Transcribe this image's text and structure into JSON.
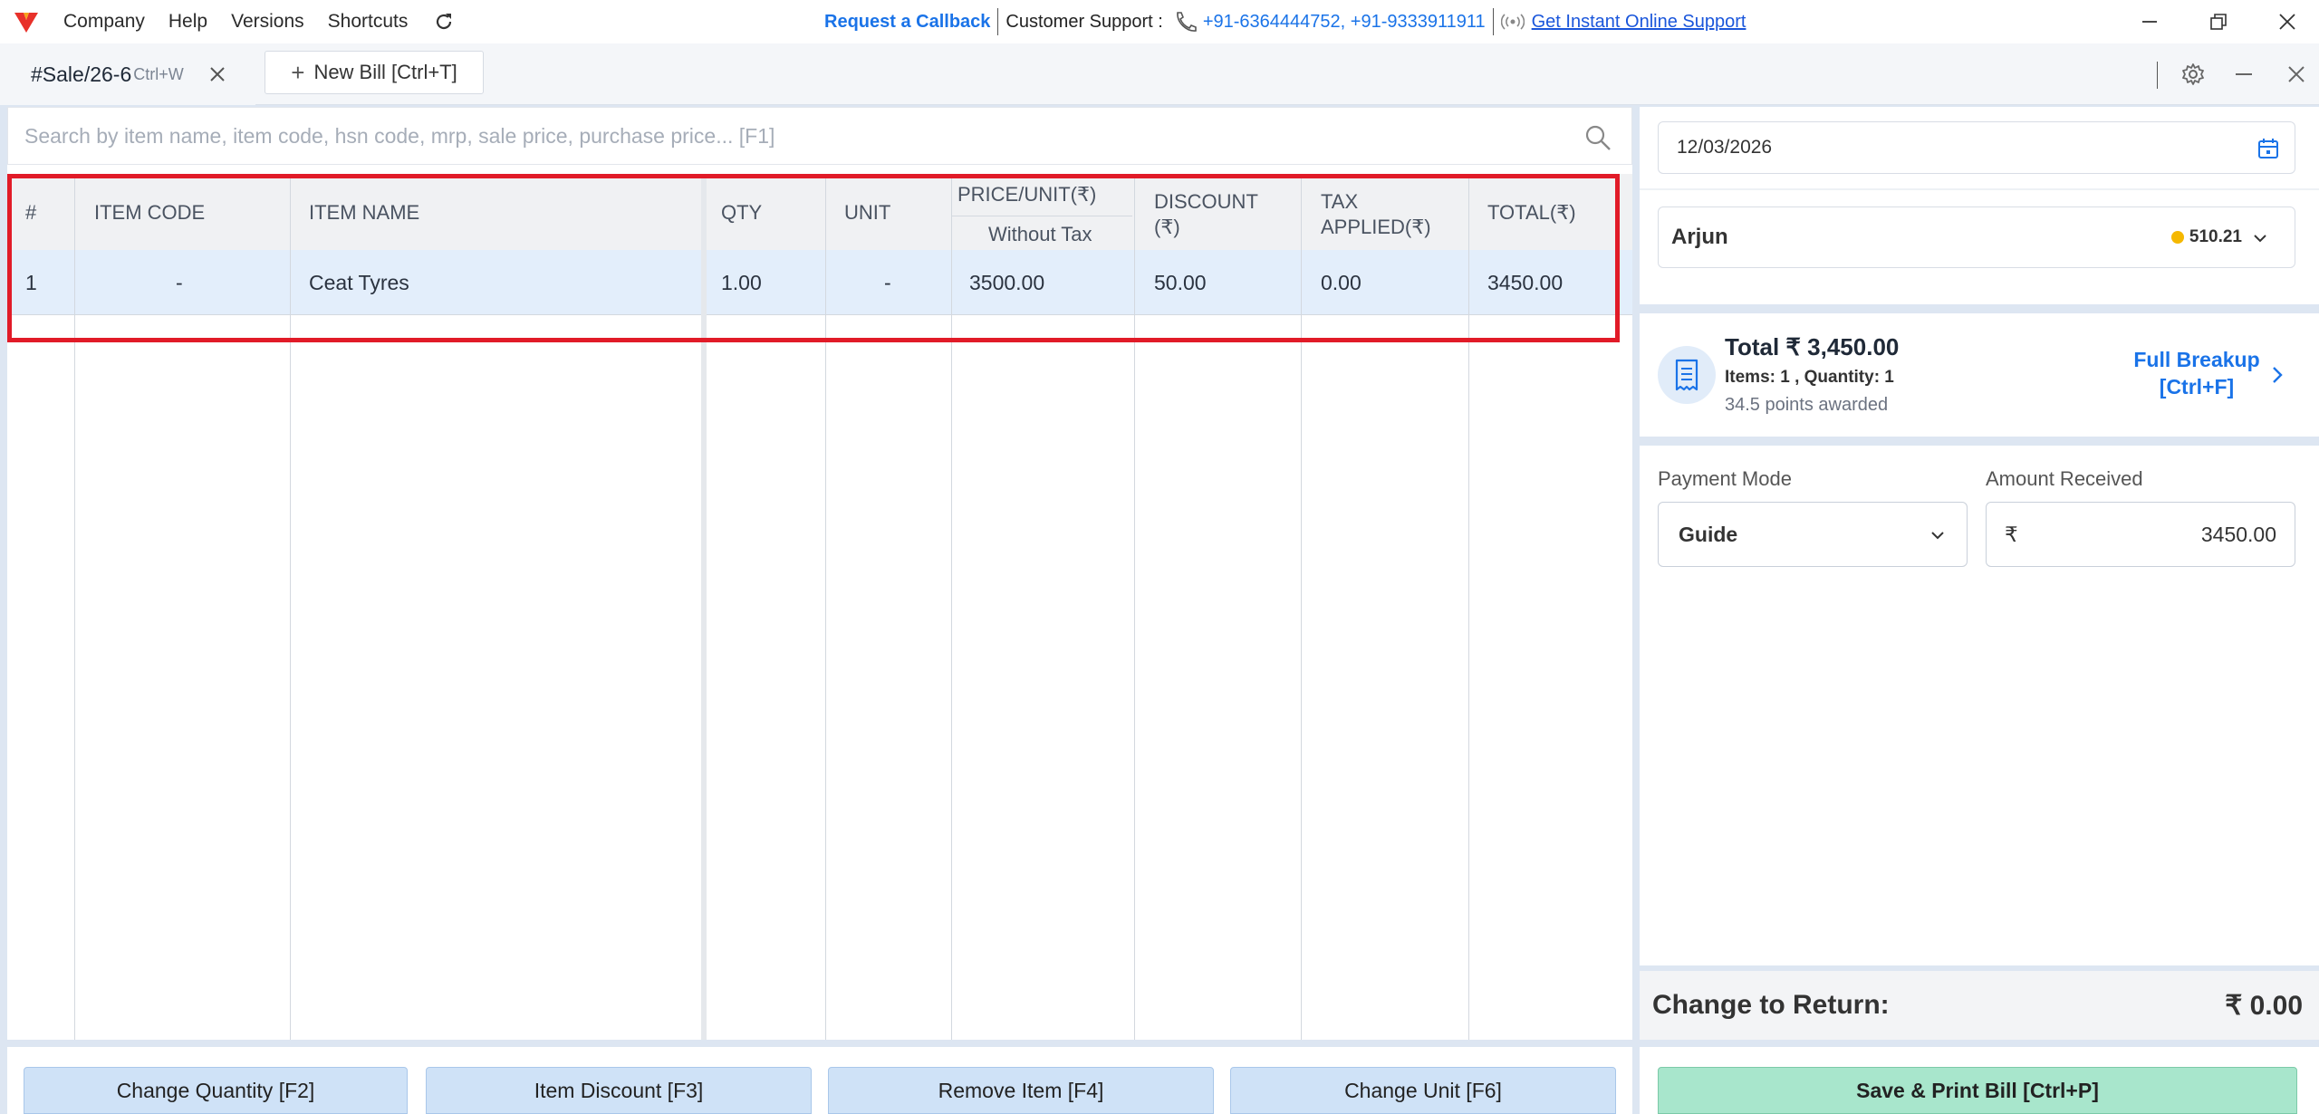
{
  "menu": {
    "items": [
      "Company",
      "Help",
      "Versions",
      "Shortcuts"
    ]
  },
  "support": {
    "callback": "Request a Callback",
    "label": "Customer Support :",
    "phones": "+91-6364444752, +91-9333911911",
    "online": "Get Instant Online Support"
  },
  "tabs": {
    "active_name": "#Sale/26-6",
    "active_shortcut": "Ctrl+W",
    "new_bill": "New Bill [Ctrl+T]"
  },
  "search": {
    "placeholder": "Search by item name, item code, hsn code, mrp, sale price, purchase price... [F1]"
  },
  "table": {
    "headers": {
      "num": "#",
      "code": "ITEM CODE",
      "name": "ITEM NAME",
      "qty": "QTY",
      "unit": "UNIT",
      "price": "PRICE/UNIT(₹)",
      "price_sub": "Without Tax",
      "discount_1": "DISCOUNT",
      "discount_2": "(₹)",
      "tax_1": "TAX",
      "tax_2": "APPLIED(₹)",
      "total": "TOTAL(₹)"
    },
    "rows": [
      {
        "num": "1",
        "code": "-",
        "name": "Ceat Tyres",
        "qty": "1.00",
        "unit": "-",
        "price": "3500.00",
        "discount": "50.00",
        "tax": "0.00",
        "total": "3450.00"
      }
    ]
  },
  "buttons": {
    "change_qty": "Change Quantity [F2]",
    "item_discount": "Item Discount [F3]",
    "remove_item": "Remove Item [F4]",
    "change_unit": "Change Unit [F6]",
    "save_print": "Save & Print Bill [Ctrl+P]"
  },
  "right": {
    "date": "12/03/2026",
    "customer": "Arjun",
    "customer_points": "510.21",
    "total": "Total ₹ 3,450.00",
    "items_qty": "Items: 1 , Quantity: 1",
    "points_awarded": "34.5 points awarded",
    "full_breakup_1": "Full Breakup",
    "full_breakup_2": "[Ctrl+F]",
    "payment_mode_label": "Payment Mode",
    "payment_mode": "Guide",
    "amount_label": "Amount Received",
    "currency": "₹",
    "amount": "3450.00",
    "change_label": "Change to Return:",
    "change_value": "₹ 0.00"
  },
  "colors": {
    "accent": "#1a73e8",
    "highlight": "#e11b28",
    "save_button": "#a8e6cc",
    "action_button": "#cfe2f7"
  }
}
